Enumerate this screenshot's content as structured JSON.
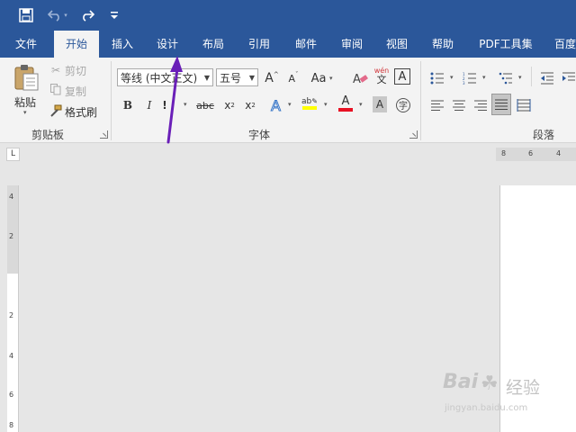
{
  "titlebar": {
    "save_icon": "save-icon",
    "undo_icon": "undo-icon",
    "redo_icon": "redo-icon",
    "customize_icon": "customize-qat-icon"
  },
  "tabs": [
    {
      "label": "文件"
    },
    {
      "label": "开始"
    },
    {
      "label": "插入"
    },
    {
      "label": "设计"
    },
    {
      "label": "布局"
    },
    {
      "label": "引用"
    },
    {
      "label": "邮件"
    },
    {
      "label": "审阅"
    },
    {
      "label": "视图"
    },
    {
      "label": "帮助"
    },
    {
      "label": "PDF工具集"
    },
    {
      "label": "百度"
    }
  ],
  "clipboard": {
    "paste": "粘贴",
    "cut": "剪切",
    "copy": "复制",
    "format_painter": "格式刷",
    "group": "剪贴板"
  },
  "font": {
    "name": "等线 (中文正文)",
    "size": "五号",
    "group": "字体",
    "phonetic": "wén",
    "phonetic_char": "文",
    "border_char": "A",
    "circle_char": "字"
  },
  "paragraph": {
    "group": "段落"
  },
  "ruler": {
    "h": [
      "8",
      "6",
      "4"
    ],
    "v": [
      "4",
      "2",
      "2",
      "4",
      "6",
      "8"
    ]
  },
  "corner": "L",
  "watermark": {
    "brand": "Bai",
    "brand2": "经验",
    "url": "jingyan.baidu.com"
  },
  "colors": {
    "title_bar": "#2b579a",
    "arrow": "#6a1fb8",
    "highlight_yellow": "#ffff00",
    "font_red": "#e81123"
  }
}
